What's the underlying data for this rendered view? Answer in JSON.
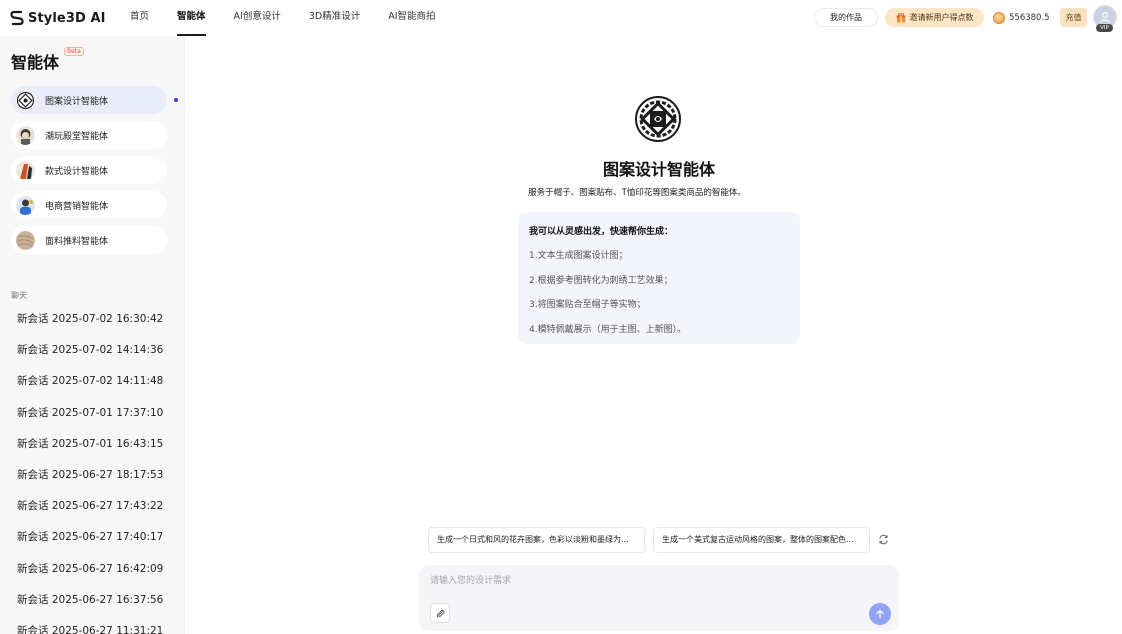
{
  "brand": {
    "name": "Style3D AI"
  },
  "nav": {
    "items": [
      {
        "label": "首页"
      },
      {
        "label": "智能体"
      },
      {
        "label": "AI创意设计"
      },
      {
        "label": "3D精准设计"
      },
      {
        "label": "AI智能商拍"
      }
    ],
    "active_index": 1
  },
  "header": {
    "works_label": "我的作品",
    "invite_label": "邀请新用户得点数",
    "points": "556380.5",
    "recharge_label": "充值",
    "vip_label": "VIP"
  },
  "sidebar": {
    "title": "智能体",
    "beta": "Beta",
    "agents": [
      {
        "label": "图案设计智能体",
        "icon": "pattern-icon"
      },
      {
        "label": "潮玩殿堂智能体",
        "icon": "toy-icon"
      },
      {
        "label": "款式设计智能体",
        "icon": "style-icon"
      },
      {
        "label": "电商营销智能体",
        "icon": "ecommerce-icon"
      },
      {
        "label": "面料推料智能体",
        "icon": "fabric-icon"
      }
    ],
    "chat_header": "聊天",
    "chats": [
      "新会话 2025-07-02 16:30:42",
      "新会话 2025-07-02 14:14:36",
      "新会话 2025-07-02 14:11:48",
      "新会话 2025-07-01 17:37:10",
      "新会话 2025-07-01 16:43:15",
      "新会话 2025-06-27 18:17:53",
      "新会话 2025-06-27 17:43:22",
      "新会话 2025-06-27 17:40:17",
      "新会话 2025-06-27 16:42:09",
      "新会话 2025-06-27 16:37:56",
      "新会话 2025-06-27 11:31:21"
    ]
  },
  "main": {
    "title": "图案设计智能体",
    "subtitle": "服务于帽子、图案贴布、T恤印花等图案类商品的智能体。",
    "intro": {
      "heading": "我可以从灵感出发，快速帮你生成：",
      "lines": [
        "1.文本生成图案设计图；",
        "2.根据参考图转化为刺绣工艺效果；",
        "3.将图案贴合至帽子等实物；",
        "4.模特佩戴展示（用于主图、上新图）。"
      ]
    },
    "suggestions": [
      "生成一个日式和风的花卉图案，色彩以淡粉和墨绿为...",
      "生成一个美式复古运动风格的图案，整体的图案配色..."
    ],
    "input": {
      "placeholder": "请输入您的设计需求",
      "value": ""
    }
  },
  "colors": {
    "accent": "#2b46d8",
    "send": "#8fa4f4",
    "invite_bg": "#fbe6c6"
  }
}
